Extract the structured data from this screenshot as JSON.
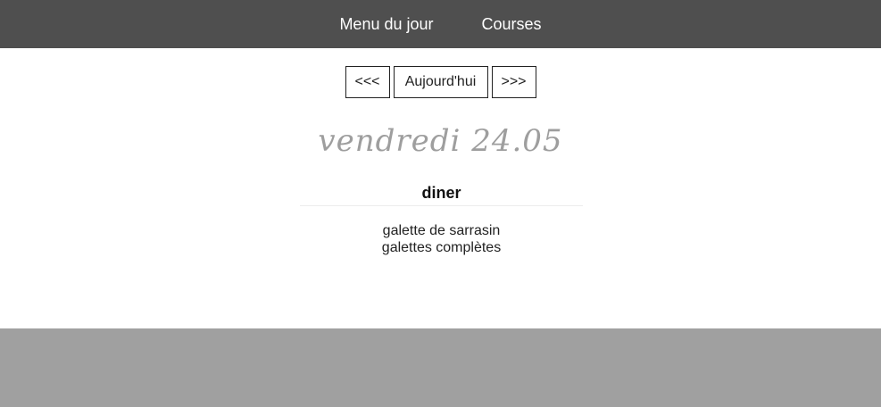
{
  "topbar": {
    "menu_du_jour": "Menu du jour",
    "courses": "Courses"
  },
  "nav": {
    "prev_label": "<<<",
    "today_label": "Aujourd'hui",
    "next_label": ">>>"
  },
  "day": {
    "date_label": "vendredi 24.05"
  },
  "meal": {
    "title": "diner",
    "items": [
      "galette de sarrasin",
      "galettes complètes"
    ]
  },
  "colors": {
    "topbar_bg": "#4f4f4f",
    "footer_bg": "#a0a0a0",
    "date_text": "#9e9e9e"
  }
}
